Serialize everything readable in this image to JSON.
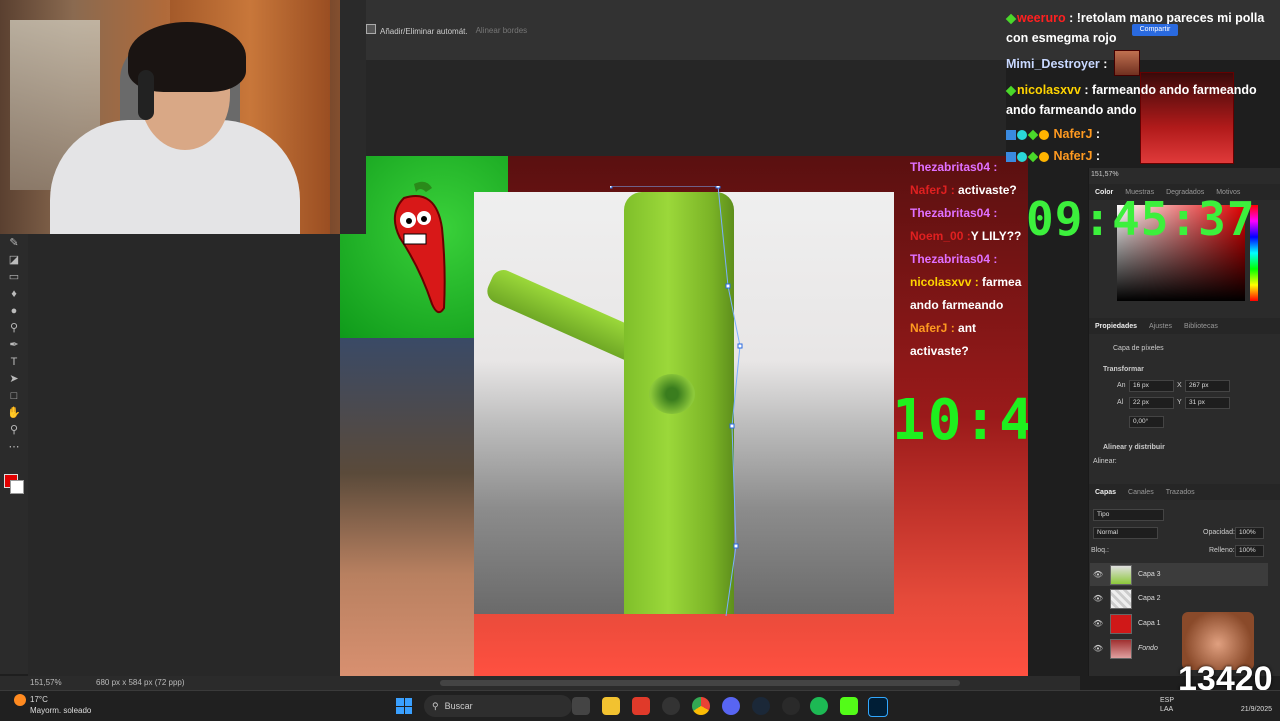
{
  "options_bar": {
    "auto_select": "Añadir/Eliminar automát.",
    "align_edges": "Alinear bordes"
  },
  "status": {
    "zoom": "151,57%",
    "doc_size": "680 px x 584 px (72 ppp)"
  },
  "canvas_chat": [
    {
      "user": "Thezabritas04 :",
      "text": ""
    },
    {
      "user": "NaferJ : ",
      "text": "activaste?"
    },
    {
      "user": "Thezabritas04 :",
      "text": ""
    },
    {
      "user": "Noem_00 :",
      "text": "Y LILY??"
    },
    {
      "user": "Thezabritas04 :",
      "text": ""
    },
    {
      "user": "nicolasxvv : ",
      "text": "farmea ando farmeando"
    },
    {
      "user": "NaferJ : ",
      "text": "ant activaste?"
    }
  ],
  "canvas_clock": "10:4",
  "chat": [
    {
      "user": "weeruro",
      "text": ": !retolam mano pareces mi polla con esmegma rojo",
      "color": "#ff2020"
    },
    {
      "user": "Mimi_Destroyer",
      "text": ":",
      "color": "#c8d8ff"
    },
    {
      "user": "nicolasxvv",
      "text": ": farmeando ando farmeando ando farmeando ando",
      "color": "#ffd400"
    },
    {
      "user": "NaferJ",
      "text": ":",
      "color": "#ff9a20"
    },
    {
      "user": "NaferJ",
      "text": ":",
      "color": "#ff9a20"
    }
  ],
  "share_button": "Compartir",
  "stream_clock": "09:45:37",
  "panels": {
    "zoom_nav": "151,57%",
    "color_tabs": [
      "Color",
      "Muestras",
      "Degradados",
      "Motivos"
    ],
    "prop_tabs": [
      "Propiedades",
      "Ajustes",
      "Bibliotecas"
    ],
    "pixel_layer": "Capa de píxeles",
    "transform": "Transformar",
    "w_label": "An",
    "w_val": "16 px",
    "x_label": "X",
    "x_val": "267 px",
    "h_label": "Al",
    "h_val": "22 px",
    "y_label": "Y",
    "y_val": "31 px",
    "angle": "0,00°",
    "align": "Alinear y distribuir",
    "align_sub": "Alinear:",
    "layer_tabs": [
      "Capas",
      "Canales",
      "Trazados"
    ],
    "kind": "Tipo",
    "blend": "Normal",
    "opacity_label": "Opacidad:",
    "opacity": "100%",
    "lock_label": "Bloq.:",
    "fill_label": "Relleno:",
    "fill": "100%",
    "layers": [
      "Capa 3",
      "Capa 2",
      "Capa 1",
      "Fondo"
    ]
  },
  "subs_count": "13420",
  "taskbar": {
    "temp": "17°C",
    "weather": "Mayorm. soleado",
    "search": "Buscar",
    "lang1": "ESP",
    "lang2": "LAA",
    "date": "21/9/2025"
  }
}
